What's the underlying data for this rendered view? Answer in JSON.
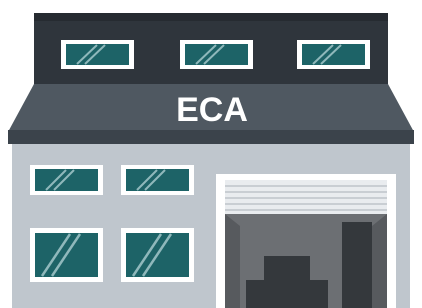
{
  "building": {
    "sign_text": "ECA",
    "colors": {
      "roof_top": "#2f353c",
      "roof_slope": "#4f5861",
      "roof_slope_shadow": "#3b434b",
      "sign_text": "#ffffff",
      "wall": "#bfc6cd",
      "window_frame": "#ffffff",
      "window_glass": "#1d6367",
      "window_glare": "#8fb8bb",
      "shutter": "#e9ecef",
      "shutter_lines": "#c9ced3",
      "garage_interior": "#6c6f73",
      "boxes": "#34383c"
    }
  }
}
